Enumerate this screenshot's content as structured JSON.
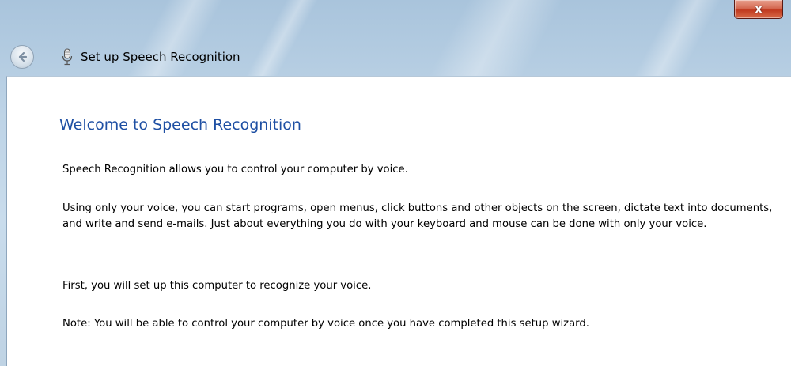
{
  "window": {
    "title": "Set up Speech Recognition",
    "close_symbol": "x"
  },
  "nav": {
    "back_icon": "back-arrow-icon",
    "app_icon": "microphone-icon"
  },
  "content": {
    "heading": "Welcome to Speech Recognition",
    "paragraphs": [
      "Speech Recognition allows you to control your computer by voice.",
      "Using only your voice, you can start programs, open menus, click buttons and other objects on the screen, dictate text into documents, and write and send e-mails. Just about everything you do with your keyboard and mouse can be done with only your voice.",
      "First, you will set up this computer to recognize your voice.",
      "Note: You will be able to control your computer by voice once you have completed this setup wizard."
    ]
  },
  "colors": {
    "heading": "#1e4fa3",
    "close_button": "#c0391f",
    "frame": "#bdd3e6"
  }
}
